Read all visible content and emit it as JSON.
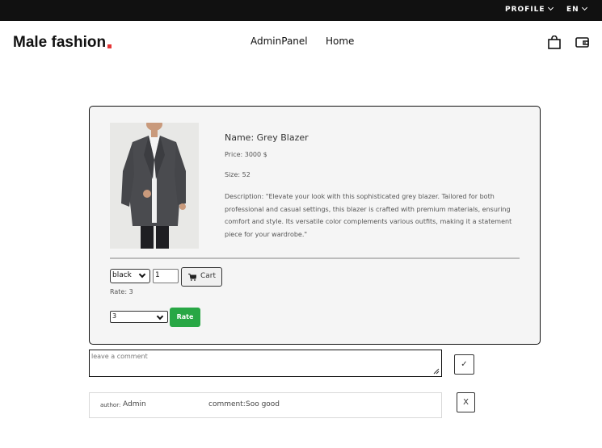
{
  "topbar": {
    "profile_label": "PROFILE",
    "language_label": "EN"
  },
  "header": {
    "logo_text": "Male fashion",
    "logo_accent_color": "#e53637",
    "nav": [
      {
        "label": "AdminPanel"
      },
      {
        "label": "Home"
      }
    ],
    "icons": [
      "shopping-bag-icon",
      "wallet-icon"
    ]
  },
  "product": {
    "name": "Name: Grey Blazer",
    "price": "Price: 3000 $",
    "size": "Size: 52",
    "description": "Description: \"Elevate your look with this sophisticated grey blazer. Tailored for both professional and casual settings, this blazer is crafted with premium materials, ensuring comfort and style. Its versatile color complements various outfits, making it a statement piece for your wardrobe.\"",
    "color_selected": "black",
    "quantity": "1",
    "cart_label": "Cart",
    "rate_text": "Rate: 3",
    "rate_selected": "3",
    "rate_button": "Rate",
    "rate_button_color": "#28a745"
  },
  "comment_form": {
    "placeholder": "leave a comment",
    "submit_label": "✓"
  },
  "comments": [
    {
      "author_label": "author:",
      "author": "Admin",
      "comment_label": "comment:",
      "text": "Soo good",
      "delete_label": "X"
    }
  ]
}
